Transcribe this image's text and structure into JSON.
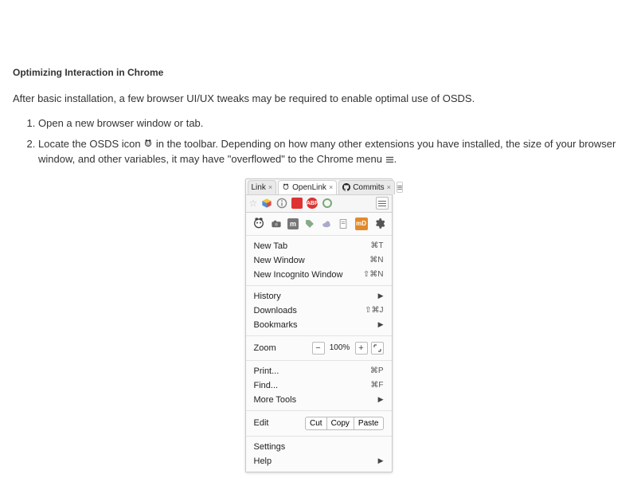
{
  "doc": {
    "heading": "Optimizing Interaction in Chrome",
    "intro": "After basic installation, a few browser UI/UX tweaks may be required to enable optimal use of OSDS.",
    "steps": [
      "Open a new browser window or tab.",
      {
        "pre": "Locate the OSDS icon ",
        "mid": " in the toolbar. Depending on how many other extensions you have installed, the size of your browser window, and other variables, it may have \"overflowed\" to the Chrome menu ",
        "post": "."
      }
    ]
  },
  "tabs": {
    "t1": "Link",
    "t2": "OpenLink",
    "t3": "Commits"
  },
  "ext_icons": {
    "abp": "ABP",
    "md": "mD"
  },
  "menu": {
    "new_tab": "New Tab",
    "new_tab_sc": "⌘T",
    "new_window": "New Window",
    "new_window_sc": "⌘N",
    "new_incog": "New Incognito Window",
    "new_incog_sc": "⇧⌘N",
    "history": "History",
    "downloads": "Downloads",
    "downloads_sc": "⇧⌘J",
    "bookmarks": "Bookmarks",
    "zoom": "Zoom",
    "zoom_value": "100%",
    "print": "Print...",
    "print_sc": "⌘P",
    "find": "Find...",
    "find_sc": "⌘F",
    "more_tools": "More Tools",
    "edit": "Edit",
    "cut": "Cut",
    "copy": "Copy",
    "paste": "Paste",
    "settings": "Settings",
    "help": "Help"
  }
}
